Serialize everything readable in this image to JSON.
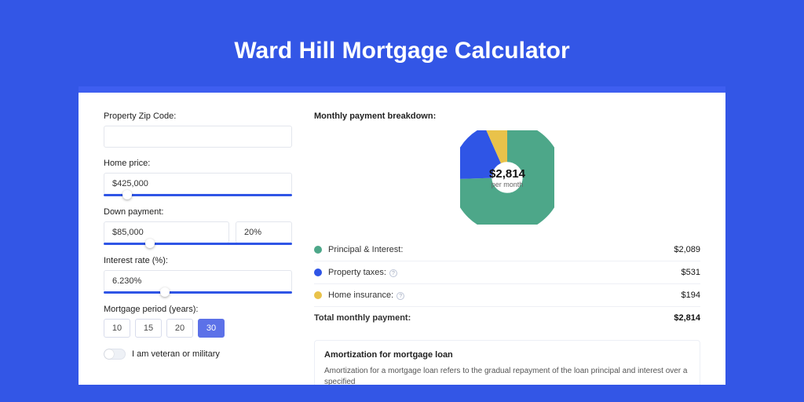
{
  "title": "Ward Hill Mortgage Calculator",
  "form": {
    "zip": {
      "label": "Property Zip Code:",
      "value": ""
    },
    "home_price": {
      "label": "Home price:",
      "value": "$425,000",
      "slider_pct": 10
    },
    "down_payment": {
      "label": "Down payment:",
      "value": "$85,000",
      "pct": "20%",
      "slider_pct": 22
    },
    "rate": {
      "label": "Interest rate (%):",
      "value": "6.230%",
      "slider_pct": 30
    },
    "period": {
      "label": "Mortgage period (years):",
      "options": [
        "10",
        "15",
        "20",
        "30"
      ],
      "active": "30"
    },
    "veteran": {
      "label": "I am veteran or military"
    }
  },
  "breakdown": {
    "header": "Monthly payment breakdown:",
    "donut_amount": "$2,814",
    "donut_sub": "per month",
    "items": [
      {
        "name": "Principal & Interest:",
        "value": "$2,089",
        "color": "#4da789",
        "info": false
      },
      {
        "name": "Property taxes:",
        "value": "$531",
        "color": "#2f55e6",
        "info": true
      },
      {
        "name": "Home insurance:",
        "value": "$194",
        "color": "#e9c24a",
        "info": true
      }
    ],
    "total": {
      "name": "Total monthly payment:",
      "value": "$2,814"
    }
  },
  "amortization": {
    "title": "Amortization for mortgage loan",
    "desc": "Amortization for a mortgage loan refers to the gradual repayment of the loan principal and interest over a specified"
  },
  "chart_data": {
    "type": "pie",
    "title": "Monthly payment breakdown",
    "series": [
      {
        "name": "Principal & Interest",
        "value": 2089,
        "color": "#4da789"
      },
      {
        "name": "Property taxes",
        "value": 531,
        "color": "#2f55e6"
      },
      {
        "name": "Home insurance",
        "value": 194,
        "color": "#e9c24a"
      }
    ],
    "total": 2814
  }
}
